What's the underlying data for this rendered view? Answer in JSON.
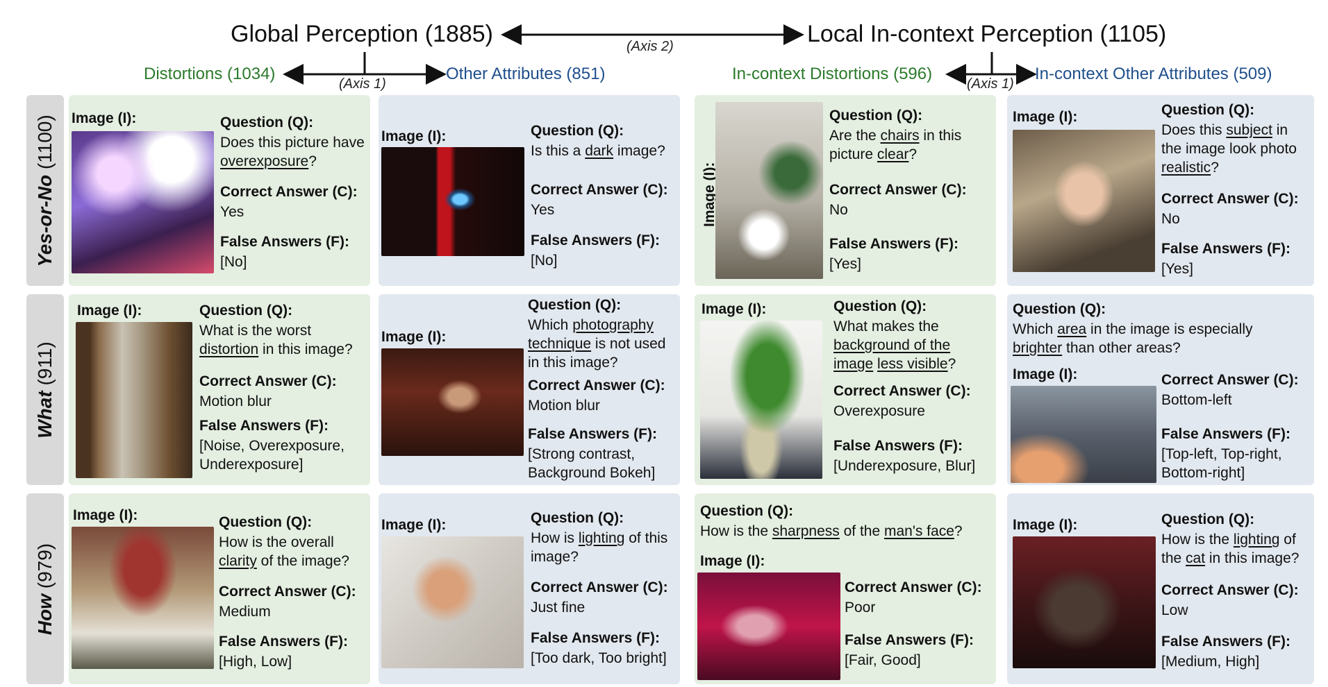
{
  "header": {
    "global": "Global Perception (1885)",
    "local": "Local In-context Perception (1105)",
    "axis2": "(Axis 2)",
    "axis1": "(Axis 1)",
    "distortions": "Distortions (1034)",
    "other_attributes": "Other Attributes (851)",
    "incontext_distortions": "In-context Distortions (596)",
    "incontext_other": "In-context Other Attributes (509)"
  },
  "rows": {
    "yesno": {
      "name": "Yes-or-No",
      "count": "(1100)"
    },
    "what": {
      "name": "What",
      "count": "(911)"
    },
    "how": {
      "name": "How",
      "count": "(979)"
    }
  },
  "labels": {
    "image": "Image (I):",
    "question": "Question (Q):",
    "correct": "Correct Answer (C):",
    "false": "False Answers (F):"
  },
  "panels": {
    "yn1": {
      "correct": "Yes",
      "false": "[No]"
    },
    "yn2": {
      "correct": "Yes",
      "false": "[No]"
    },
    "yn3": {
      "correct": "No",
      "false": "[Yes]"
    },
    "yn4": {
      "correct": "No",
      "false": "[Yes]"
    },
    "wh1": {
      "correct": "Motion blur",
      "false": "[Noise, Overexposure, Underexposure]"
    },
    "wh2": {
      "correct": "Motion blur",
      "false": "[Strong contrast, Background Bokeh]"
    },
    "wh3": {
      "correct": "Overexposure",
      "false": "[Underexposure, Blur]"
    },
    "wh4": {
      "correct": "Bottom-left",
      "false": "[Top-left, Top-right, Bottom-right]"
    },
    "hw1": {
      "correct": "Medium",
      "false": "[High, Low]"
    },
    "hw2": {
      "correct": "Just fine",
      "false": "[Too dark, Too bright]"
    },
    "hw3": {
      "correct": "Poor",
      "false": "[Fair, Good]"
    },
    "hw4": {
      "correct": "Low",
      "false": "[Medium, High]"
    }
  },
  "colors": {
    "green_panel": "#e4efe1",
    "blue_panel": "#e2e8ef",
    "green_text": "#2b7a2b",
    "blue_text": "#1f4e8c"
  }
}
